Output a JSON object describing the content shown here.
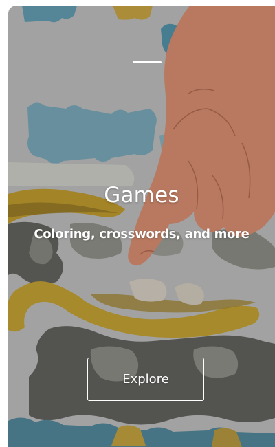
{
  "card": {
    "title": "Games",
    "subtitle": "Coloring, crosswords, and more",
    "button_label": "Explore"
  },
  "background": {
    "description_icon": "puzzle-image-icon",
    "colors": {
      "puzzle_gray": "#9a9a98",
      "puzzle_blue": "#5e9db1",
      "puzzle_yellow": "#c9a127",
      "hand": "#d98a6c"
    }
  }
}
